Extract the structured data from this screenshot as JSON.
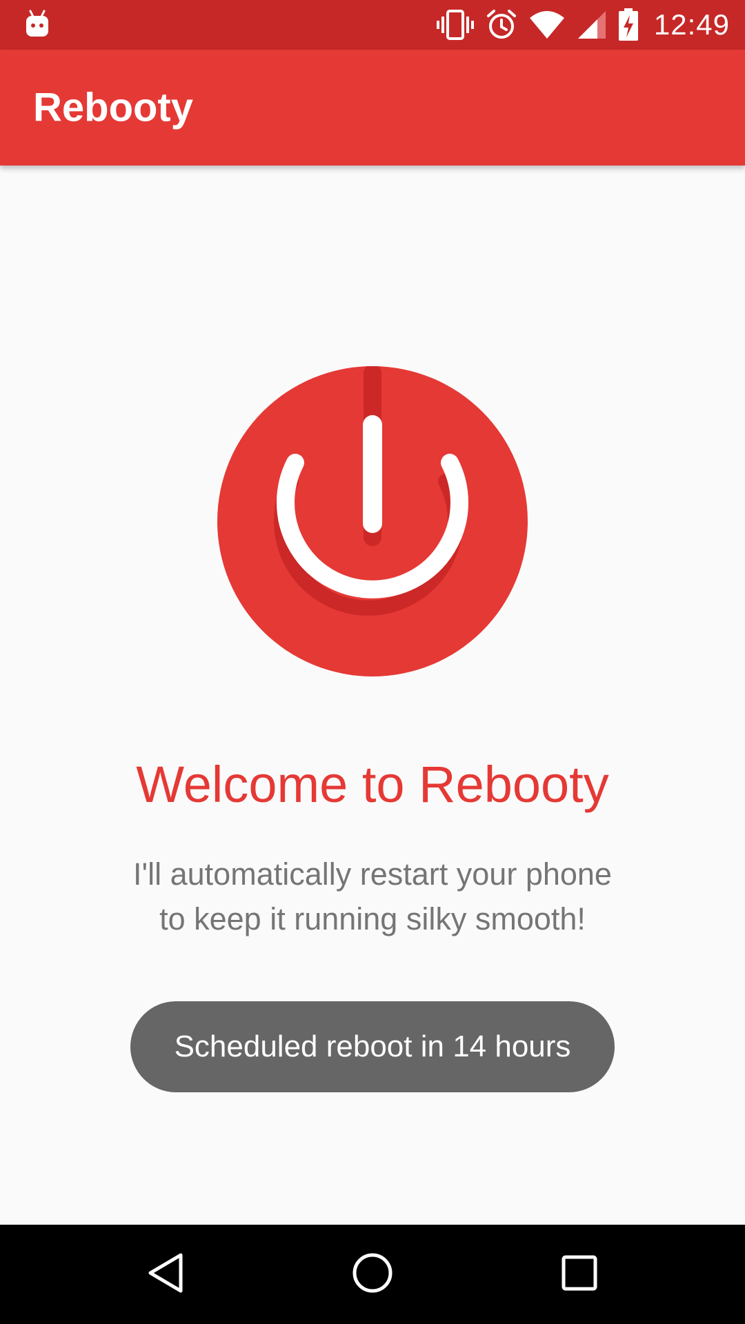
{
  "status_bar": {
    "time": "12:49",
    "icons": [
      "android-debug-icon",
      "vibrate-icon",
      "alarm-icon",
      "wifi-icon",
      "cell-signal-icon",
      "battery-charging-icon"
    ],
    "background": "#c62828"
  },
  "app_bar": {
    "title": "Rebooty",
    "background": "#e53935"
  },
  "main": {
    "logo_icon": "power-icon",
    "welcome_title": "Welcome to Rebooty",
    "welcome_line1": "I'll automatically restart your phone",
    "welcome_line2": "to keep it running silky smooth!",
    "toast": "Scheduled reboot in 14 hours",
    "accent_color": "#e53935"
  },
  "nav_bar": {
    "buttons": [
      "back-icon",
      "home-icon",
      "recents-icon"
    ]
  }
}
